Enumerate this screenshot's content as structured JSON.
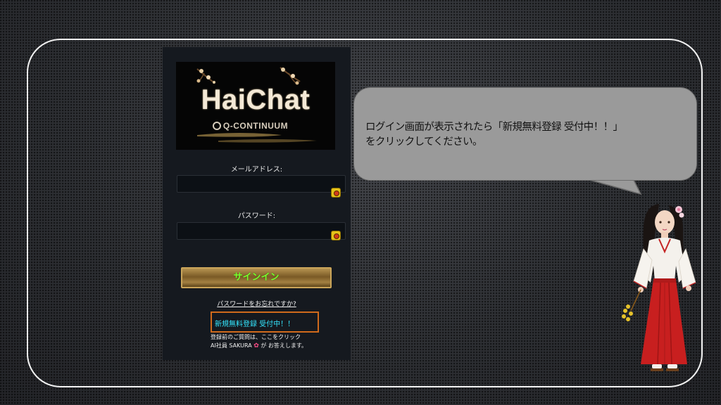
{
  "logo": {
    "title": "HaiChat",
    "subtitle": "Q-CONTINUUM"
  },
  "login": {
    "email_label": "メールアドレス:",
    "email_value": "",
    "email_icon": "password-manager-icon",
    "password_label": "パスワード:",
    "password_value": "",
    "password_icon": "password-manager-icon",
    "signin_label": "サインイン",
    "forgot_label": "パスワードをお忘れですか?",
    "register_label": "新規無料登録 受付中！！",
    "help_line1": "登録前のご質問は、ここをクリック",
    "help_line2_prefix": "AI社員 SAKURA",
    "help_icon": "sakura-flower-icon",
    "help_line2_suffix": " が お答えします。"
  },
  "bubble": {
    "line1": "ログイン画面が表示されたら「新規無料登録 受付中！！」",
    "line2": "をクリックしてください。"
  },
  "colors": {
    "signin_text": "#7cff2f",
    "register_text": "#34e7ff",
    "register_border": "#d06a1c",
    "bubble_bg": "#9a9a9a",
    "frame": "#f2f2f2"
  }
}
